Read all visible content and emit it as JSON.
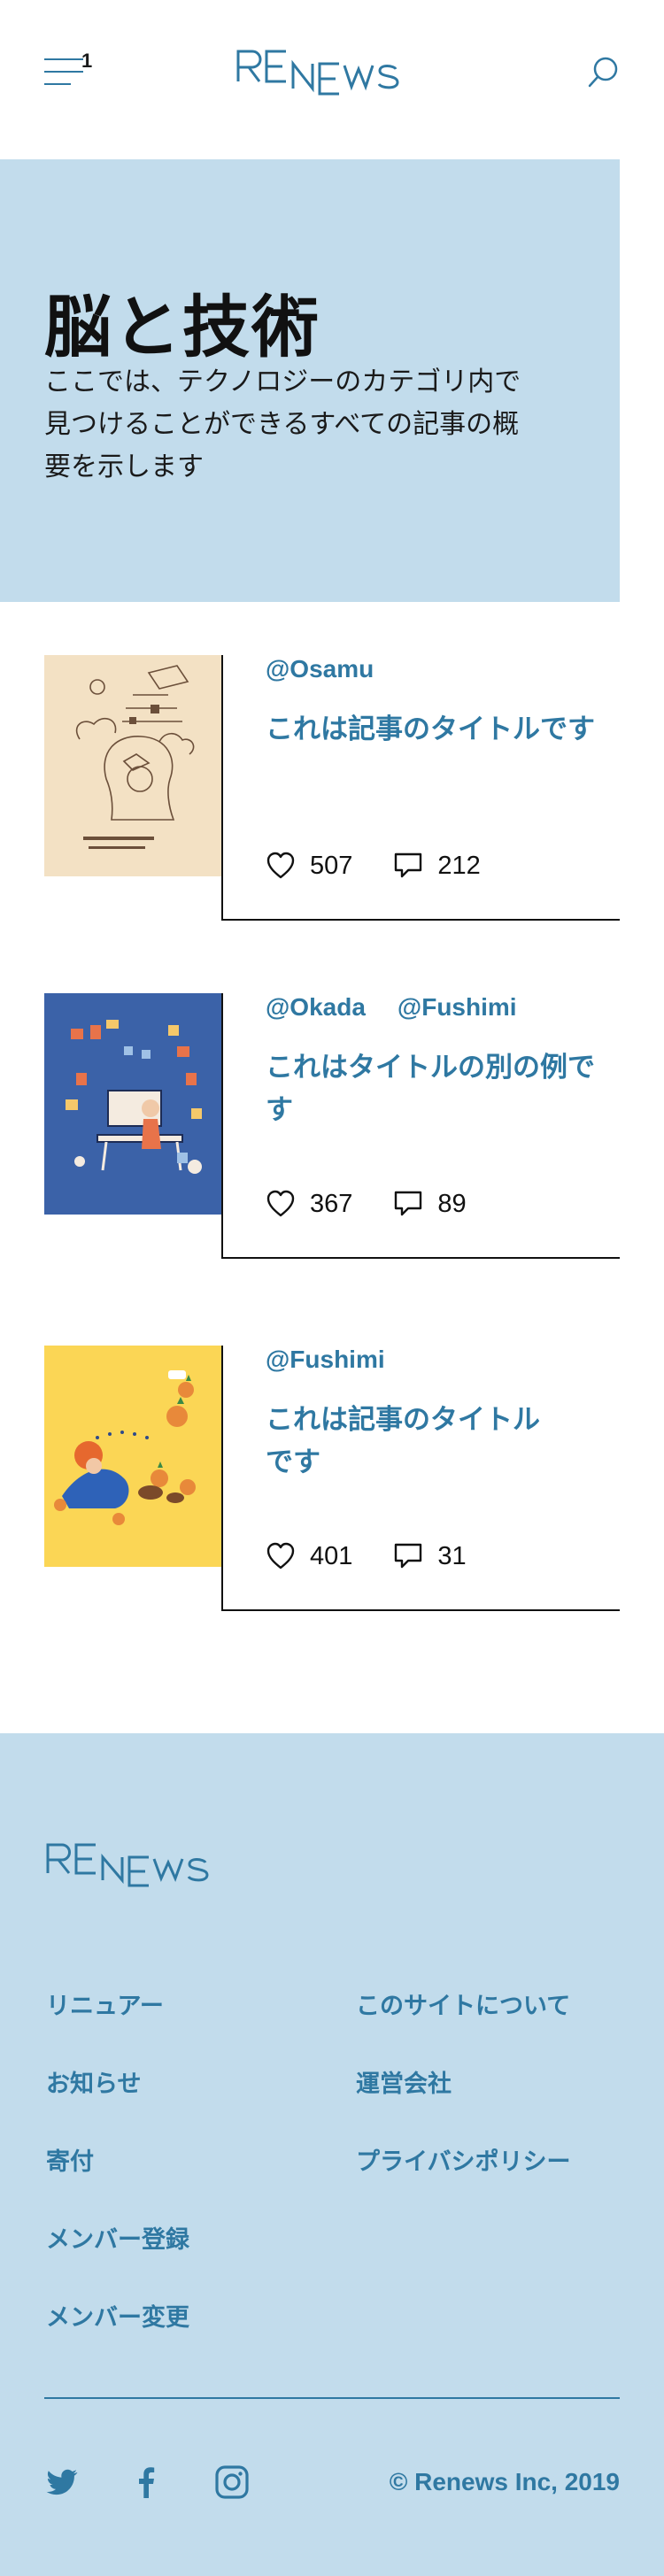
{
  "header": {
    "menu_badge": "1",
    "logo_text": "RENEWS"
  },
  "hero": {
    "title": "脳と技術",
    "description": "ここでは、テクノロジーのカテゴリ内で見つけることができるすべての記事の概要を示します"
  },
  "articles": [
    {
      "authors": [
        "@Osamu"
      ],
      "title": "これは記事のタイトルです",
      "likes": "507",
      "comments": "212"
    },
    {
      "authors": [
        "@Okada",
        "@Fushimi"
      ],
      "title": "これはタイトルの別の例です",
      "likes": "367",
      "comments": "89"
    },
    {
      "authors": [
        "@Fushimi"
      ],
      "title": "これは記事のタイトルです",
      "likes": "401",
      "comments": "31"
    }
  ],
  "footer": {
    "logo_text": "RENEWS",
    "nav_left": [
      "リニュアー",
      "お知らせ",
      "寄付",
      "メンバー登録",
      "メンバー変更"
    ],
    "nav_right": [
      "このサイトについて",
      "運営会社",
      "プライバシポリシー"
    ],
    "social": [
      "twitter-icon",
      "facebook-icon",
      "instagram-icon"
    ],
    "copyright": "© Renews Inc, 2019"
  },
  "colors": {
    "brand": "#2f78a2",
    "hero_bg": "#c2dcec",
    "footer_bg": "#c2dcec",
    "text": "#111111"
  }
}
